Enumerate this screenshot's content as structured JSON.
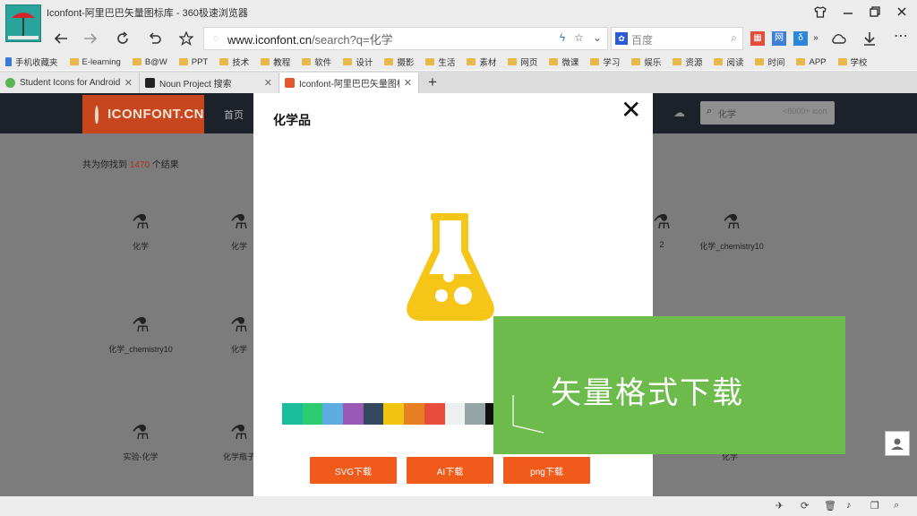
{
  "window": {
    "title": "Iconfont-阿里巴巴矢量图标库 - 360极速浏览器"
  },
  "address_bar": {
    "url_domain": "www.iconfont.cn",
    "url_path": "/search?q=化学",
    "search_placeholder": "百度"
  },
  "bookmarks": [
    {
      "label": "手机收藏夹",
      "icon": "phone-icon"
    },
    {
      "label": "E-learning",
      "icon": "folder-icon"
    },
    {
      "label": "B@W",
      "icon": "folder-icon"
    },
    {
      "label": "PPT",
      "icon": "folder-icon"
    },
    {
      "label": "技术",
      "icon": "folder-icon"
    },
    {
      "label": "教程",
      "icon": "folder-icon"
    },
    {
      "label": "软件",
      "icon": "folder-icon"
    },
    {
      "label": "设计",
      "icon": "folder-icon"
    },
    {
      "label": "摄影",
      "icon": "folder-icon"
    },
    {
      "label": "生活",
      "icon": "folder-icon"
    },
    {
      "label": "素材",
      "icon": "folder-icon"
    },
    {
      "label": "网页",
      "icon": "folder-icon"
    },
    {
      "label": "微课",
      "icon": "folder-icon"
    },
    {
      "label": "学习",
      "icon": "folder-icon"
    },
    {
      "label": "娱乐",
      "icon": "folder-icon"
    },
    {
      "label": "资源",
      "icon": "folder-icon"
    },
    {
      "label": "阅读",
      "icon": "folder-icon"
    },
    {
      "label": "时间",
      "icon": "folder-icon"
    },
    {
      "label": "APP",
      "icon": "folder-icon"
    },
    {
      "label": "学校",
      "icon": "folder-icon"
    }
  ],
  "tabs": [
    {
      "label": "Student Icons for Android",
      "color": "#5ab552"
    },
    {
      "label": "Noun Project 搜索",
      "color": "#222222"
    },
    {
      "label": "Iconfont-阿里巴巴矢量图标库",
      "color": "#e2572b"
    }
  ],
  "site": {
    "logo_text": "ICONFONT.CN",
    "nav_home": "首页",
    "search_text": "化学",
    "search_hint": "<8000+ icon",
    "result_prefix": "共为你找到",
    "result_count": "1470",
    "result_suffix": "个结果",
    "grid_items": [
      {
        "label": "化学",
        "icon": "flask-icon"
      },
      {
        "label": "化学",
        "icon": "flask-icon"
      },
      {
        "label": "2",
        "icon": "flask-icon"
      },
      {
        "label": "化学_chemistry10",
        "icon": "flask-icon"
      },
      {
        "label": "化学_chemistry10",
        "icon": "flask-icon"
      },
      {
        "label": "化学",
        "icon": "flask-icon"
      },
      {
        "label": "实验-化学",
        "icon": "test-tube-icon"
      },
      {
        "label": "化学瓶子",
        "icon": "flask-icon"
      },
      {
        "label": "化学",
        "icon": "flask-icon"
      }
    ]
  },
  "modal": {
    "title": "化学品",
    "close_symbol": "✕",
    "icon_color": "#f5c518",
    "swatches": [
      "#1abc9c",
      "#2ecc71",
      "#5dade2",
      "#9b59b6",
      "#34495e",
      "#f1c40f",
      "#e67e22",
      "#e74c3c",
      "#ecf0f1",
      "#95a5a6",
      "#111111"
    ],
    "buttons": {
      "svg": "SVG下载",
      "ai": "AI下载",
      "png": "png下载"
    }
  },
  "overlay": {
    "text": "矢量格式下载",
    "color": "#6cbb4c"
  }
}
